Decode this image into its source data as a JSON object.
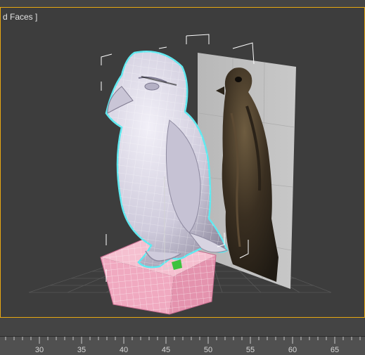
{
  "viewport": {
    "label": "[ Shaded + Edged Faces ]",
    "label_visible": "d Faces ]",
    "border_color": "#e8a812"
  },
  "timeline": {
    "ticks": [
      "30",
      "35",
      "40",
      "45",
      "50",
      "55",
      "60",
      "65"
    ]
  },
  "colors": {
    "background": "#3d3d3d",
    "mesh": "#d9d6e2",
    "selection_outline": "#5fe9f0",
    "pedestal": "#f2b6c8",
    "reference_plane": "#bfbfbf"
  }
}
